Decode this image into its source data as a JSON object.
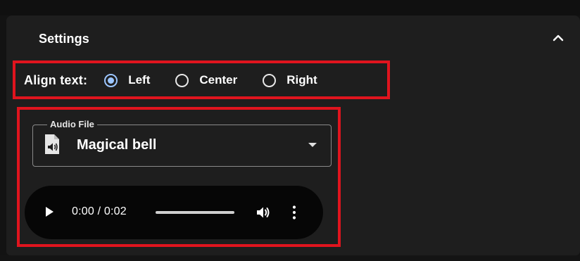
{
  "settings": {
    "title": "Settings",
    "collapse_icon": "chevron-up-icon"
  },
  "align": {
    "label": "Align text:",
    "options": [
      {
        "label": "Left",
        "selected": true
      },
      {
        "label": "Center",
        "selected": false
      },
      {
        "label": "Right",
        "selected": false
      }
    ]
  },
  "audio_select": {
    "legend": "Audio File",
    "value": "Magical bell",
    "icon": "audio-file-icon"
  },
  "player": {
    "time": "0:00 / 0:02",
    "progress": 0,
    "play_icon": "play-icon",
    "volume_icon": "volume-icon",
    "more_icon": "more-vertical-icon"
  },
  "colors": {
    "accent": "#9cc6ff",
    "highlight": "#e0141e",
    "panel_bg": "#1e1e1e"
  }
}
